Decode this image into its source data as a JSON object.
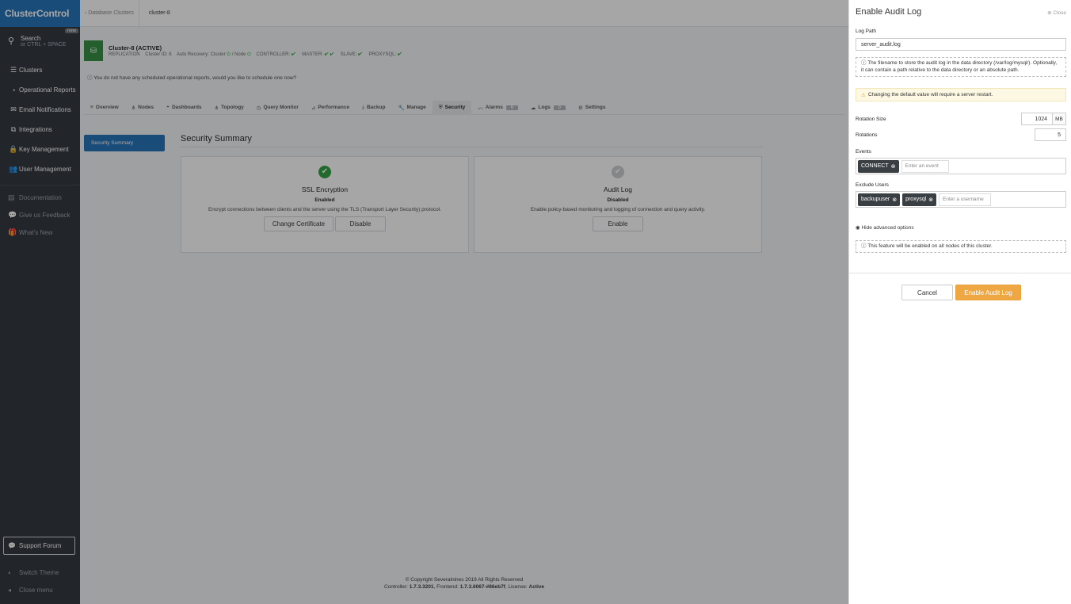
{
  "sidebar": {
    "brand": "ClusterControl",
    "search_label": "Search",
    "search_hint": "or CTRL + SPACE",
    "new_badge": "new",
    "items": [
      {
        "label": "Clusters",
        "icon": "clusters-icon",
        "glyph": "☰"
      },
      {
        "label": "Operational Reports",
        "icon": "reports-icon",
        "glyph": "◔"
      },
      {
        "label": "Email Notifications",
        "icon": "mail-icon",
        "glyph": "✉"
      },
      {
        "label": "Integrations",
        "icon": "puzzle-icon",
        "glyph": "⧉"
      },
      {
        "label": "Key Management",
        "icon": "lock-icon",
        "glyph": "🔒"
      },
      {
        "label": "User Management",
        "icon": "users-icon",
        "glyph": "👥"
      }
    ],
    "sub_items": [
      {
        "label": "Documentation",
        "icon": "book-icon",
        "glyph": "▤"
      },
      {
        "label": "Give us Feedback",
        "icon": "comment-icon",
        "glyph": "💬"
      },
      {
        "label": "What's New",
        "icon": "gift-icon",
        "glyph": "🎁"
      }
    ],
    "support": "Support Forum",
    "switch_theme": "Switch Theme",
    "close_menu": "Close menu"
  },
  "topbar": {
    "breadcrumb": "Database Clusters",
    "cluster": "cluster-8"
  },
  "cluster": {
    "name": "Cluster-8 (ACTIVE)",
    "type": "REPLICATION",
    "id": "Cluster ID: 8",
    "auto_recovery": "Auto Recovery: Cluster",
    "node_label": "/ Node",
    "controller": "CONTROLLER:",
    "master": "MASTER:",
    "slave": "SLAVE:",
    "proxysql": "PROXYSQL:"
  },
  "notice": "You do not have any scheduled operational reports, would you like to schedule one now?",
  "tabs": [
    {
      "label": "Overview",
      "glyph": "≡"
    },
    {
      "label": "Nodes",
      "glyph": "⋔"
    },
    {
      "label": "Dashboards",
      "glyph": "◓"
    },
    {
      "label": "Topology",
      "glyph": "⋔"
    },
    {
      "label": "Query Monitor",
      "glyph": "◷"
    },
    {
      "label": "Performance",
      "glyph": "⊿"
    },
    {
      "label": "Backup",
      "glyph": "⤓"
    },
    {
      "label": "Manage",
      "glyph": "🔧"
    },
    {
      "label": "Security",
      "glyph": "⛨",
      "active": true
    },
    {
      "label": "Alarms",
      "glyph": "〰",
      "count": "0"
    },
    {
      "label": "Logs",
      "glyph": "☁",
      "count": "0"
    },
    {
      "label": "Settings",
      "glyph": "⚙"
    }
  ],
  "side_tab": "Security Summary",
  "section_title": "Security Summary",
  "cards": {
    "ssl": {
      "title": "SSL Encryption",
      "status": "Enabled",
      "desc": "Encrypt connections between clients and the server using the TLS (Transport Layer Security) protocol.",
      "btn1": "Change Certificate",
      "btn2": "Disable"
    },
    "audit": {
      "title": "Audit Log",
      "status": "Disabled",
      "desc": "Enable policy-based monitoring and logging of connection and query activity.",
      "btn1": "Enable"
    }
  },
  "footer": {
    "copyright": "© Copyright Severalnines 2019 All Rights Reserved",
    "versions_prefix": "Controller: ",
    "controller_version": "1.7.3.3201",
    "frontend_prefix": ", Frontend: ",
    "frontend_version": "1.7.3.6067-#86eb7f",
    "license_prefix": ", License: ",
    "license": "Active"
  },
  "drawer": {
    "title": "Enable Audit Log",
    "close": "Close",
    "log_path_label": "Log Path",
    "log_path_value": "server_audit.log",
    "log_path_help": "The filename to store the audit log in the data directory (/var/log/mysql/). Optionally, it can contain a path relative to the data directory or an absolute path.",
    "warning": "Changing the default value will require a server restart.",
    "rotation_size_label": "Rotation Size",
    "rotation_size_value": "1024",
    "rotation_size_unit": "MB",
    "rotations_label": "Rotations",
    "rotations_value": "5",
    "events_label": "Events",
    "events_tags": [
      "CONNECT"
    ],
    "events_placeholder": "Enter an event",
    "exclude_label": "Exclude Users",
    "exclude_tags": [
      "backupuser",
      "proxysql"
    ],
    "exclude_placeholder": "Enter a username",
    "advanced": "Hide advanced options",
    "cluster_note": "This feature will be enabled on all nodes of this cluster.",
    "cancel": "Cancel",
    "submit": "Enable Audit Log"
  },
  "colors": {
    "brand": "#1e6fb5",
    "sidebar": "#2a3035",
    "success": "#2a9d3a",
    "primary_action": "#efa743"
  }
}
